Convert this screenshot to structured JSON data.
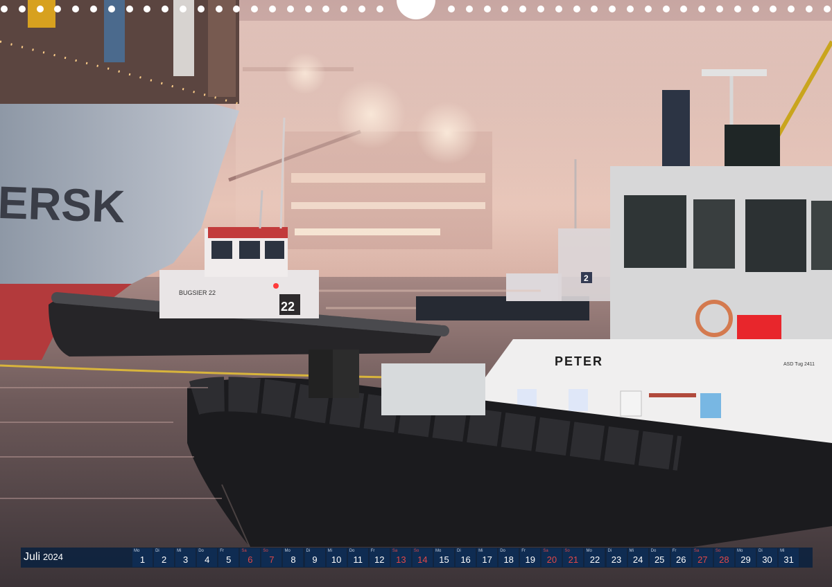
{
  "photo": {
    "bow_letters": "ERSK",
    "tug_left_name": "BUGSIER 22",
    "tug_left_number": "22",
    "tug_mid_number": "2",
    "tug_front_name": "PETER",
    "tug_front_plate": "ASD Tug 2411"
  },
  "calendar": {
    "month": "Juli",
    "year": "2024",
    "days": [
      {
        "dn": "Mo",
        "dd": "1",
        "weekend": false
      },
      {
        "dn": "Di",
        "dd": "2",
        "weekend": false
      },
      {
        "dn": "Mi",
        "dd": "3",
        "weekend": false
      },
      {
        "dn": "Do",
        "dd": "4",
        "weekend": false
      },
      {
        "dn": "Fr",
        "dd": "5",
        "weekend": false
      },
      {
        "dn": "Sa",
        "dd": "6",
        "weekend": true
      },
      {
        "dn": "So",
        "dd": "7",
        "weekend": true
      },
      {
        "dn": "Mo",
        "dd": "8",
        "weekend": false
      },
      {
        "dn": "Di",
        "dd": "9",
        "weekend": false
      },
      {
        "dn": "Mi",
        "dd": "10",
        "weekend": false
      },
      {
        "dn": "Do",
        "dd": "11",
        "weekend": false
      },
      {
        "dn": "Fr",
        "dd": "12",
        "weekend": false
      },
      {
        "dn": "Sa",
        "dd": "13",
        "weekend": true
      },
      {
        "dn": "So",
        "dd": "14",
        "weekend": true
      },
      {
        "dn": "Mo",
        "dd": "15",
        "weekend": false
      },
      {
        "dn": "Di",
        "dd": "16",
        "weekend": false
      },
      {
        "dn": "Mi",
        "dd": "17",
        "weekend": false
      },
      {
        "dn": "Do",
        "dd": "18",
        "weekend": false
      },
      {
        "dn": "Fr",
        "dd": "19",
        "weekend": false
      },
      {
        "dn": "Sa",
        "dd": "20",
        "weekend": true
      },
      {
        "dn": "So",
        "dd": "21",
        "weekend": true
      },
      {
        "dn": "Mo",
        "dd": "22",
        "weekend": false
      },
      {
        "dn": "Di",
        "dd": "23",
        "weekend": false
      },
      {
        "dn": "Mi",
        "dd": "24",
        "weekend": false
      },
      {
        "dn": "Do",
        "dd": "25",
        "weekend": false
      },
      {
        "dn": "Fr",
        "dd": "26",
        "weekend": false
      },
      {
        "dn": "Sa",
        "dd": "27",
        "weekend": true
      },
      {
        "dn": "So",
        "dd": "28",
        "weekend": true
      },
      {
        "dn": "Mo",
        "dd": "29",
        "weekend": false
      },
      {
        "dn": "Di",
        "dd": "30",
        "weekend": false
      },
      {
        "dn": "Mi",
        "dd": "31",
        "weekend": false
      }
    ]
  }
}
